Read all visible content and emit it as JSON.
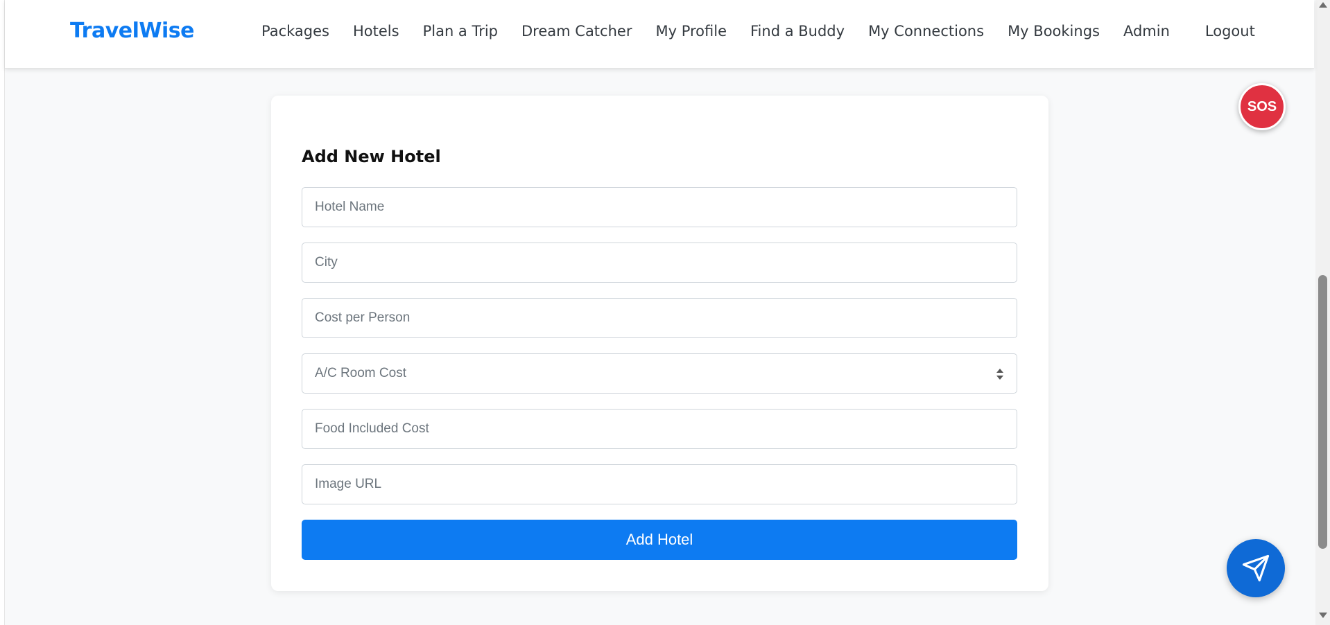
{
  "navbar": {
    "brand": "TravelWise",
    "links": [
      {
        "label": "Packages"
      },
      {
        "label": "Hotels"
      },
      {
        "label": "Plan a Trip"
      },
      {
        "label": "Dream Catcher"
      },
      {
        "label": "My Profile"
      },
      {
        "label": "Find a Buddy"
      },
      {
        "label": "My Connections"
      },
      {
        "label": "My Bookings"
      },
      {
        "label": "Admin"
      }
    ],
    "logout_label": "Logout"
  },
  "form": {
    "title": "Add New Hotel",
    "fields": {
      "hotel_name": {
        "placeholder": "Hotel Name",
        "value": ""
      },
      "city": {
        "placeholder": "City",
        "value": ""
      },
      "cost_per_person": {
        "placeholder": "Cost per Person",
        "value": ""
      },
      "ac_room_cost": {
        "selected": "A/C Room Cost"
      },
      "food_included_cost": {
        "placeholder": "Food Included Cost",
        "value": ""
      },
      "image_url": {
        "placeholder": "Image URL",
        "value": ""
      }
    },
    "submit_label": "Add Hotel"
  },
  "sos": {
    "label": "SOS"
  },
  "fab": {
    "icon": "send-icon"
  },
  "colors": {
    "brand": "#0d7bf2",
    "primary_button": "#0d7bf2",
    "sos": "#e03141",
    "fab": "#0f6ad6"
  }
}
